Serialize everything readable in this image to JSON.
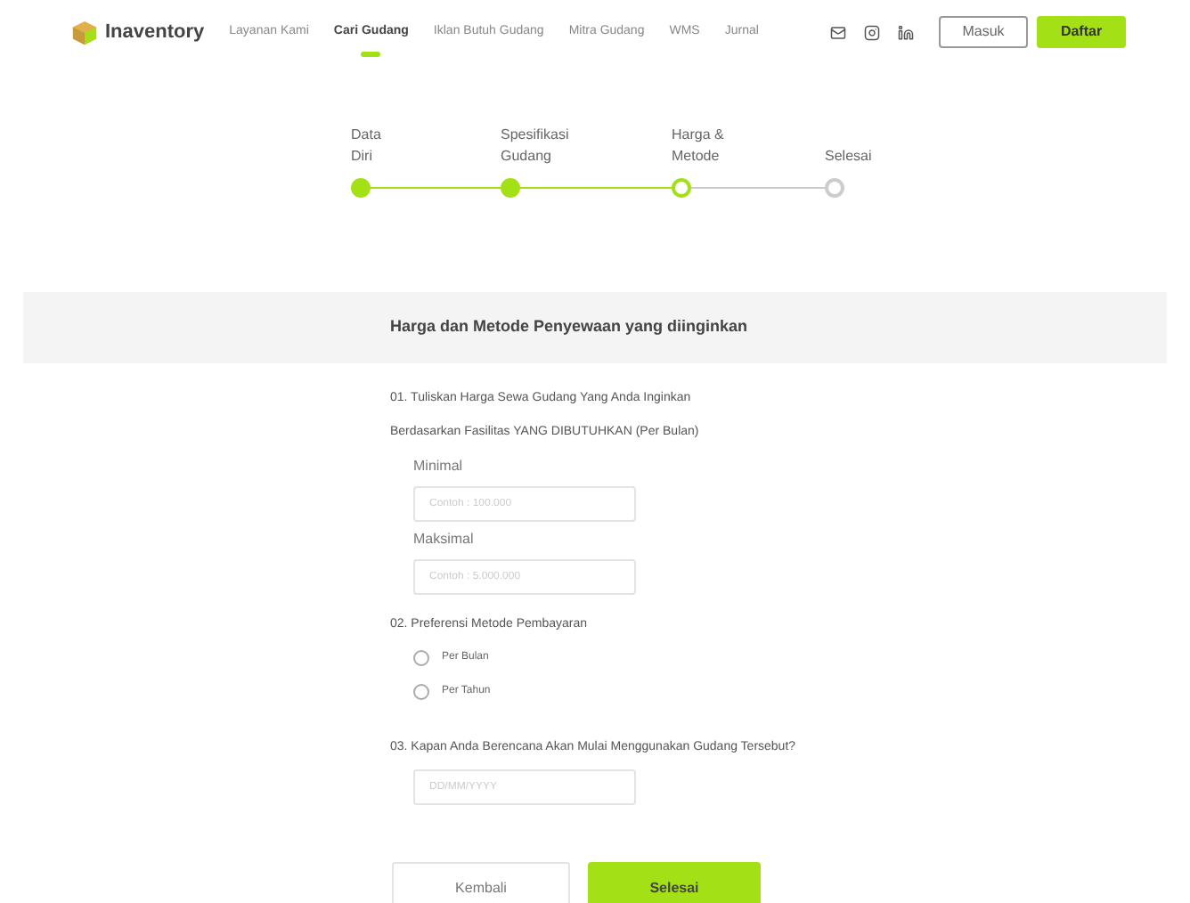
{
  "nav": {
    "brand": "Inaventory",
    "links": [
      {
        "label": "Layanan Kami",
        "selected": false
      },
      {
        "label": "Cari Gudang",
        "selected": true
      },
      {
        "label": "Iklan Butuh Gudang",
        "selected": false
      },
      {
        "label": "Mitra Gudang",
        "selected": false
      },
      {
        "label": "WMS",
        "selected": false
      },
      {
        "label": "Jurnal",
        "selected": false
      }
    ],
    "login": "Masuk",
    "register": "Daftar"
  },
  "steps": [
    {
      "label_lines": [
        "Data",
        "Diri"
      ],
      "completed": true,
      "current": false
    },
    {
      "label_lines": [
        "Spesifikasi",
        "Gudang"
      ],
      "completed": true,
      "current": false
    },
    {
      "label_lines": [
        "Harga &",
        "Metode"
      ],
      "completed": false,
      "current": true
    },
    {
      "label_lines": [
        "Selesai"
      ],
      "completed": false,
      "current": false
    }
  ],
  "section_title": "Harga dan Metode Penyewaan yang diinginkan",
  "q1": {
    "lines": [
      "01. Tuliskan Harga Sewa Gudang Yang Anda Inginkan",
      "Berdasarkan Fasilitas YANG DIBUTUHKAN (Per Bulan)"
    ],
    "fields": [
      {
        "label": "Minimal",
        "placeholder": "Contoh : 100.000"
      },
      {
        "label": "Maksimal",
        "placeholder": "Contoh : 5.000.000"
      }
    ]
  },
  "q2": {
    "title": "02. Preferensi Metode Pembayaran",
    "options": [
      {
        "label": "Per Bulan",
        "selected": false
      },
      {
        "label": "Per Tahun",
        "selected": false
      }
    ]
  },
  "q3": {
    "title": "03. Kapan Anda Berencana Akan Mulai Menggunakan Gudang Tersebut?",
    "placeholder": "DD/MM/YYYY"
  },
  "buttons": {
    "back": "Kembali",
    "finish": "Selesai"
  }
}
